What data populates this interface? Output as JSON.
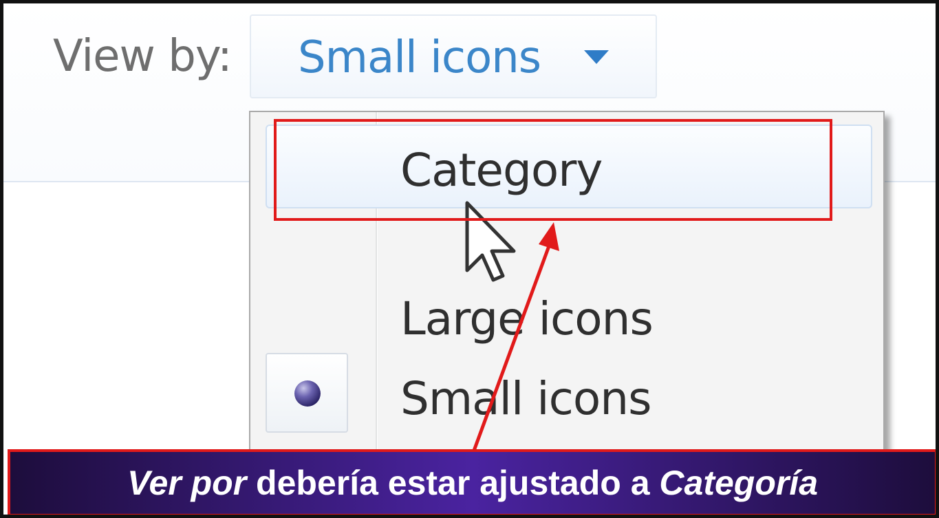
{
  "view_by": {
    "label": "View by:",
    "value": "Small icons"
  },
  "menu": {
    "items": [
      {
        "label": "Category",
        "highlighted": true,
        "selected": false
      },
      {
        "label": "Large icons",
        "highlighted": false,
        "selected": false
      },
      {
        "label": "Small icons",
        "highlighted": false,
        "selected": true
      }
    ]
  },
  "caption": {
    "part1": "Ver por",
    "part2": " debería estar ajustado a ",
    "part3": "Categoría"
  },
  "colors": {
    "annotation_red": "#e11a1a",
    "banner_purple": "#4a23a0",
    "link_blue": "#3b86c9"
  }
}
